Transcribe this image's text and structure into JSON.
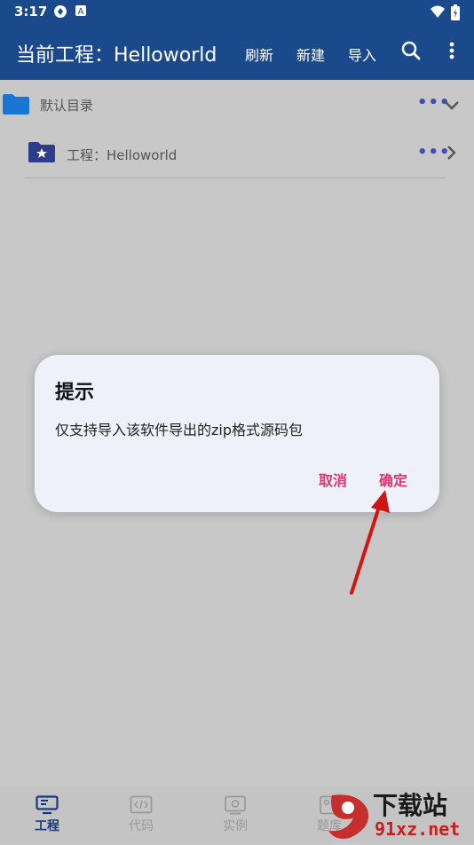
{
  "status_bar": {
    "time": "3:17"
  },
  "app_bar": {
    "title": "当前工程：Helloworld",
    "actions": [
      "刷新",
      "新建",
      "导入"
    ],
    "search_icon": "search-icon",
    "more_icon": "more-vert-icon"
  },
  "tree": {
    "root": {
      "label": "默认目录",
      "more": "•••"
    },
    "child": {
      "label": "工程：Helloworld",
      "more": "•••"
    }
  },
  "dialog": {
    "title": "提示",
    "message": "仅支持导入该软件导出的zip格式源码包",
    "cancel": "取消",
    "confirm": "确定"
  },
  "bottom_nav": {
    "items": [
      {
        "label": "工程",
        "icon": "monitor-icon",
        "active": true
      },
      {
        "label": "代码",
        "icon": "code-icon",
        "active": false
      },
      {
        "label": "实例",
        "icon": "gear-icon",
        "active": false
      },
      {
        "label": "题库",
        "icon": "book-icon",
        "active": false
      }
    ]
  },
  "watermark": {
    "line1": "下载站",
    "line2": "91xz.net"
  },
  "colors": {
    "primary": "#1a4a8c",
    "accent": "#e3336a",
    "folder_blue": "#1976d2",
    "folder_dark": "#2c3e8a"
  }
}
